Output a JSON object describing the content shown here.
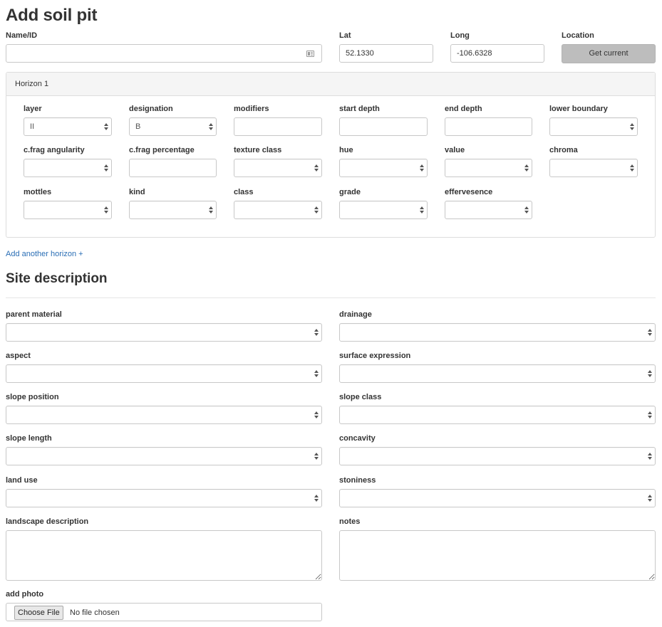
{
  "page": {
    "title": "Add soil pit"
  },
  "header_fields": {
    "name": {
      "label": "Name/ID",
      "value": "",
      "icon": "contact-card-icon"
    },
    "lat": {
      "label": "Lat",
      "value": "52.1330"
    },
    "long": {
      "label": "Long",
      "value": "-106.6328"
    },
    "location": {
      "label": "Location",
      "button": "Get current"
    }
  },
  "horizon": {
    "title": "Horizon 1",
    "fields": {
      "layer": {
        "label": "layer",
        "value": "II"
      },
      "designation": {
        "label": "designation",
        "value": "B"
      },
      "modifiers": {
        "label": "modifiers",
        "value": ""
      },
      "start_depth": {
        "label": "start depth",
        "value": ""
      },
      "end_depth": {
        "label": "end depth",
        "value": ""
      },
      "lower_boundary": {
        "label": "lower boundary",
        "value": ""
      },
      "cfrag_angularity": {
        "label": "c.frag angularity",
        "value": ""
      },
      "cfrag_percentage": {
        "label": "c.frag percentage",
        "value": ""
      },
      "texture_class": {
        "label": "texture class",
        "value": ""
      },
      "hue": {
        "label": "hue",
        "value": ""
      },
      "value": {
        "label": "value",
        "value": ""
      },
      "chroma": {
        "label": "chroma",
        "value": ""
      },
      "mottles": {
        "label": "mottles",
        "value": ""
      },
      "kind": {
        "label": "kind",
        "value": ""
      },
      "class": {
        "label": "class",
        "value": ""
      },
      "grade": {
        "label": "grade",
        "value": ""
      },
      "effervesence": {
        "label": "effervesence",
        "value": ""
      }
    }
  },
  "add_horizon": {
    "label": "Add another horizon +"
  },
  "site": {
    "title": "Site description",
    "fields": {
      "parent_material": {
        "label": "parent material",
        "value": ""
      },
      "drainage": {
        "label": "drainage",
        "value": ""
      },
      "aspect": {
        "label": "aspect",
        "value": ""
      },
      "surface_expression": {
        "label": "surface expression",
        "value": ""
      },
      "slope_position": {
        "label": "slope position",
        "value": ""
      },
      "slope_class": {
        "label": "slope class",
        "value": ""
      },
      "slope_length": {
        "label": "slope length",
        "value": ""
      },
      "concavity": {
        "label": "concavity",
        "value": ""
      },
      "land_use": {
        "label": "land use",
        "value": ""
      },
      "stoniness": {
        "label": "stoniness",
        "value": ""
      },
      "landscape_description": {
        "label": "landscape description",
        "value": ""
      },
      "notes": {
        "label": "notes",
        "value": ""
      }
    },
    "photo": {
      "label": "add photo",
      "button": "Choose File",
      "status": "No file chosen"
    }
  }
}
